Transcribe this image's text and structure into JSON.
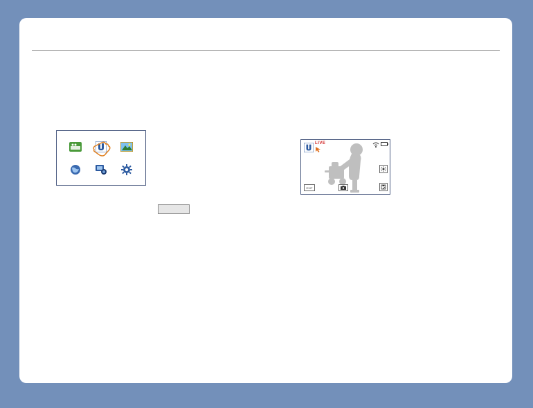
{
  "icon_panel": {
    "icons": [
      "camera-icon",
      "u-icon",
      "picture-icon",
      "globe-icon",
      "device-icon",
      "gear-icon"
    ]
  },
  "camera_preview": {
    "live_label": "LIVE",
    "exit_label": "EXIT"
  },
  "colors": {
    "frame_blue": "#4a5a80",
    "accent_blue": "#2c5aa0",
    "silhouette": "#bfbfbf"
  }
}
